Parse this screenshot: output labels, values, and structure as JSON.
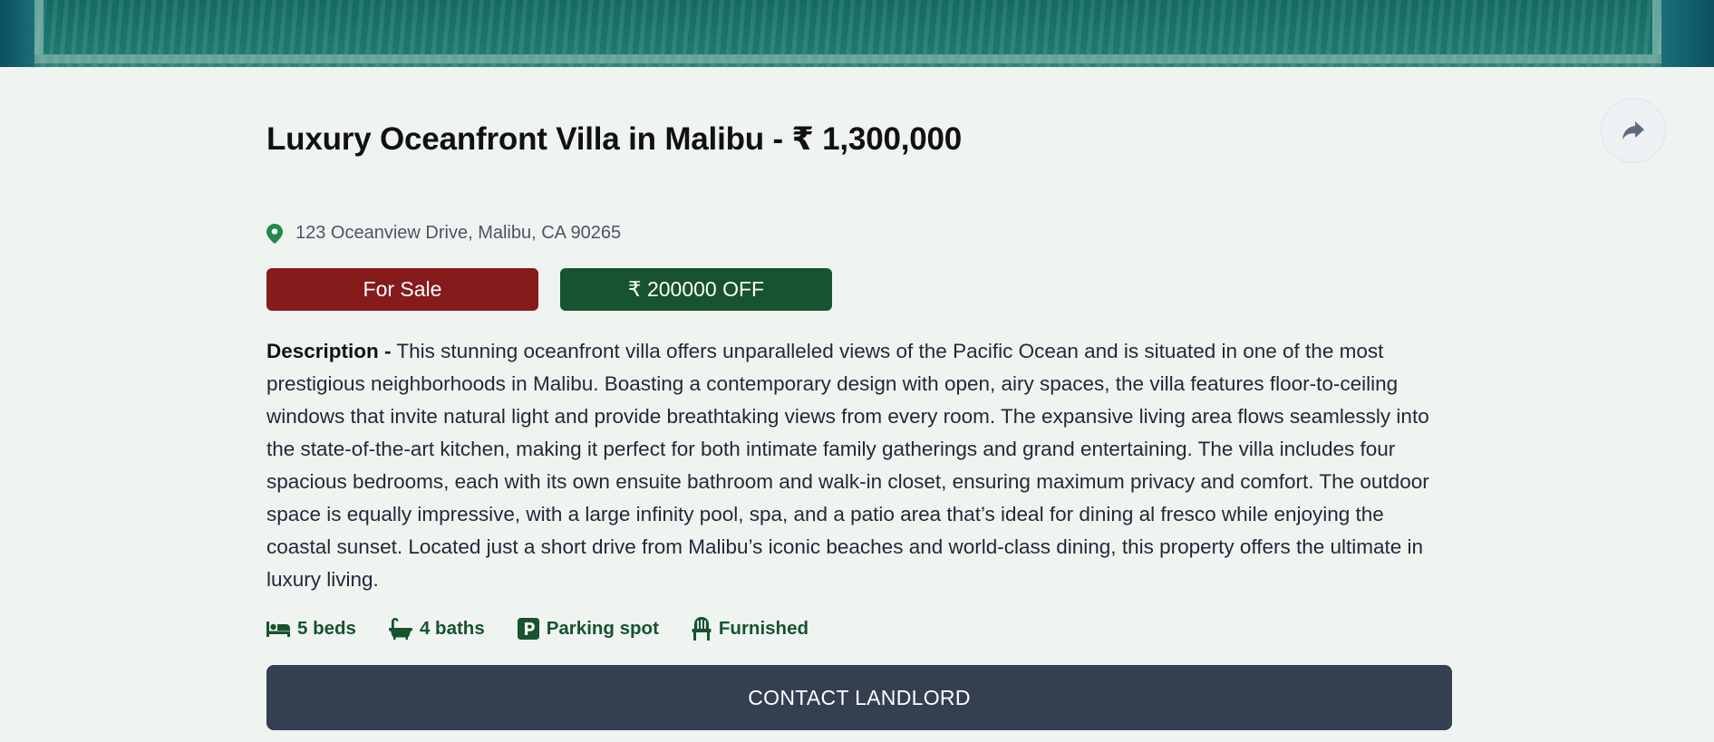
{
  "listing": {
    "title": "Luxury Oceanfront Villa in Malibu - ₹ 1,300,000",
    "address": "123 Oceanview Drive, Malibu, CA 90265",
    "status_badge": "For Sale",
    "discount_badge": "₹ 200000 OFF",
    "description_label": "Description -",
    "description_text": "This stunning oceanfront villa offers unparalleled views of the Pacific Ocean and is situated in one of the most prestigious neighborhoods in Malibu. Boasting a contemporary design with open, airy spaces, the villa features floor-to-ceiling windows that invite natural light and provide breathtaking views from every room. The expansive living area flows seamlessly into the state-of-the-art kitchen, making it perfect for both intimate family gatherings and grand entertaining. The villa includes four spacious bedrooms, each with its own ensuite bathroom and walk-in closet, ensuring maximum privacy and comfort. The outdoor space is equally impressive, with a large infinity pool, spa, and a patio area that’s ideal for dining al fresco while enjoying the coastal sunset. Located just a short drive from Malibu’s iconic beaches and world-class dining, this property offers the ultimate in luxury living.",
    "features": {
      "beds": "5 beds",
      "baths": "4 baths",
      "parking": "Parking spot",
      "furnished": "Furnished"
    },
    "contact_button": "CONTACT LANDLORD"
  },
  "icons": {
    "share": "share-icon",
    "location": "location-pin-icon",
    "beds": "bed-icon",
    "baths": "bath-icon",
    "parking": "parking-icon",
    "furnished": "chair-icon"
  },
  "colors": {
    "background": "#eff4f1",
    "sale_badge": "#861b1b",
    "discount_badge": "#16532e",
    "feature_text": "#16532e",
    "pin": "#1f8a4c",
    "contact_button": "#343f52"
  }
}
